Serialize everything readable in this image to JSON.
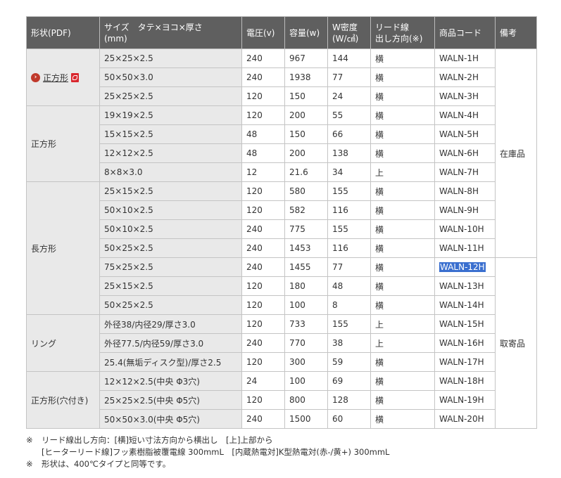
{
  "header": {
    "shape": "形状(PDF)",
    "size_line1": "サイズ　タテ×ヨコ×厚さ",
    "size_line2": "(mm)",
    "voltage": "電圧(v)",
    "capacity": "容量(w)",
    "density_line1": "W密度",
    "density_line2": "(W/㎠)",
    "lead_line1": "リード線",
    "lead_line2": "出し方向(※)",
    "code": "商品コード",
    "note": "備考"
  },
  "groups": [
    {
      "shape": "正方形",
      "linked": true
    },
    {
      "shape": "正方形"
    },
    {
      "shape": "長方形"
    },
    {
      "shape": "リング"
    },
    {
      "shape": "正方形(穴付き)"
    }
  ],
  "notes_col": [
    "在庫品",
    "取寄品"
  ],
  "rows": [
    {
      "size": "25×25×2.5",
      "voltage": "240",
      "capacity": "967",
      "density": "144",
      "lead": "横",
      "code": "WALN-1H"
    },
    {
      "size": "50×50×3.0",
      "voltage": "240",
      "capacity": "1938",
      "density": "77",
      "lead": "横",
      "code": "WALN-2H"
    },
    {
      "size": "25×25×2.5",
      "voltage": "120",
      "capacity": "150",
      "density": "24",
      "lead": "横",
      "code": "WALN-3H"
    },
    {
      "size": "19×19×2.5",
      "voltage": "120",
      "capacity": "200",
      "density": "55",
      "lead": "横",
      "code": "WALN-4H"
    },
    {
      "size": "15×15×2.5",
      "voltage": "48",
      "capacity": "150",
      "density": "66",
      "lead": "横",
      "code": "WALN-5H"
    },
    {
      "size": "12×12×2.5",
      "voltage": "48",
      "capacity": "200",
      "density": "138",
      "lead": "横",
      "code": "WALN-6H"
    },
    {
      "size": "8×8×3.0",
      "voltage": "12",
      "capacity": "21.6",
      "density": "34",
      "lead": "上",
      "code": "WALN-7H"
    },
    {
      "size": "25×15×2.5",
      "voltage": "120",
      "capacity": "580",
      "density": "155",
      "lead": "横",
      "code": "WALN-8H"
    },
    {
      "size": "50×10×2.5",
      "voltage": "120",
      "capacity": "582",
      "density": "116",
      "lead": "横",
      "code": "WALN-9H"
    },
    {
      "size": "50×10×2.5",
      "voltage": "240",
      "capacity": "775",
      "density": "155",
      "lead": "横",
      "code": "WALN-10H"
    },
    {
      "size": "50×25×2.5",
      "voltage": "240",
      "capacity": "1453",
      "density": "116",
      "lead": "横",
      "code": "WALN-11H"
    },
    {
      "size": "75×25×2.5",
      "voltage": "240",
      "capacity": "1455",
      "density": "77",
      "lead": "横",
      "code": "WALN-12H"
    },
    {
      "size": "25×15×2.5",
      "voltage": "120",
      "capacity": "180",
      "density": "48",
      "lead": "横",
      "code": "WALN-13H"
    },
    {
      "size": "50×25×2.5",
      "voltage": "120",
      "capacity": "100",
      "density": "8",
      "lead": "横",
      "code": "WALN-14H"
    },
    {
      "size": "外径38/内径29/厚さ3.0",
      "voltage": "120",
      "capacity": "733",
      "density": "155",
      "lead": "上",
      "code": "WALN-15H"
    },
    {
      "size": "外径77.5/内径59/厚さ3.0",
      "voltage": "240",
      "capacity": "770",
      "density": "38",
      "lead": "上",
      "code": "WALN-16H"
    },
    {
      "size": "25.4(無垢ディスク型)/厚さ2.5",
      "voltage": "120",
      "capacity": "300",
      "density": "59",
      "lead": "横",
      "code": "WALN-17H"
    },
    {
      "size": "12×12×2.5(中央 Φ3穴)",
      "voltage": "24",
      "capacity": "100",
      "density": "69",
      "lead": "横",
      "code": "WALN-18H"
    },
    {
      "size": "25×25×2.5(中央 Φ5穴)",
      "voltage": "120",
      "capacity": "800",
      "density": "128",
      "lead": "横",
      "code": "WALN-19H"
    },
    {
      "size": "50×50×3.0(中央 Φ5穴)",
      "voltage": "240",
      "capacity": "1500",
      "density": "60",
      "lead": "横",
      "code": "WALN-20H"
    }
  ],
  "footnotes": {
    "mark": "※",
    "line1": "リード線出し方向：[横]短い寸法方向から横出し　[上]上部から",
    "line2": "[ヒーターリード線]フッ素樹脂被覆電線 300mmL　[内蔵熱電対]K型熱電対(赤-/黄+) 300mmL",
    "line3": "形状は、400℃タイプと同等です。"
  }
}
